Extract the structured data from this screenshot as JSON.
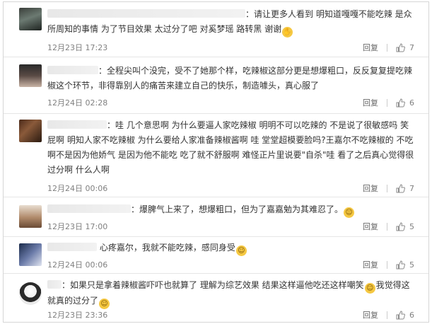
{
  "reply_label": "回复",
  "comments": [
    {
      "username": "",
      "text": "请让更多人看到 明知道嘎嘎不能吃辣 是众所周知的事情 为了节目效果 太过分了吧 对奚梦瑶 路转黑 谢谢",
      "emoji": "🙏",
      "time": "12月23日 17:23",
      "likes": "7"
    },
    {
      "username": "",
      "text": "全程尖叫个没完，受不了她那个样，吃辣椒这部分更是想爆粗口，反反复复提吃辣椒这个环节，非得靠别人的痛苦来建立自己的快乐，制造噱头，真心服了",
      "time": "12月24日 02:28",
      "likes": "6"
    },
    {
      "username": "",
      "text": "哇 几个意思啊 为什么要逼人家吃辣椒 明明不可以吃辣的 不是说了很敏感吗 笑屁啊 明知人家不吃辣椒 为什么要给人家准备辣椒酱啊 哇 堂堂超模要脸吗?王嘉尔不吃辣椒的 不吃啊不是因为他娇气 是因为他不能吃 吃了就不舒服啊 难怪正片里说要\"自杀\"哇 看了之后真心觉得很过分啊 什么人啊",
      "time": "12月24日 00:06",
      "likes": "7"
    },
    {
      "username": "",
      "text": "爆脾气上来了，想爆粗口，但为了嘉嘉勉为其难忍了。",
      "time": "12月23日 17:00",
      "likes": "5"
    },
    {
      "username": "",
      "text": "心疼嘉尔，我就不能吃辣，感同身受",
      "time": "12月24日 00:06",
      "likes": "5"
    },
    {
      "username": "",
      "text": "如果只是拿着辣椒酱吓吓也就算了 理解为综艺效果 结果这样逼他吃还这样嘲笑",
      "text2": "我觉得这就真的过分了",
      "time": "12月23日 23:36",
      "likes": "6"
    }
  ]
}
